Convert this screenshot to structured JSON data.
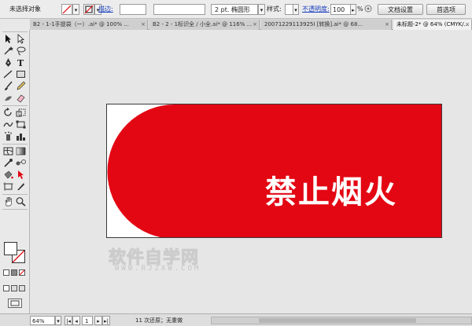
{
  "control_bar": {
    "selection_status": "未选择对象",
    "stroke_label": "描边:",
    "stroke_width": "2 pt. 椭圆形",
    "style_label": "样式:",
    "opacity_label": "不透明度:",
    "opacity_value": "100",
    "opacity_unit": "%",
    "doc_setup_button": "文档设置",
    "preferences_button": "首选项"
  },
  "tabs": [
    {
      "label": "B2 - 1-1手提袋（一）.ai* @ 100% ...",
      "active": false
    },
    {
      "label": "B2 - 2 - 1标识全 / 小全.ai* @ 116% ...",
      "active": false
    },
    {
      "label": "20071229113925I [转换].ai* @ 68...",
      "active": false
    },
    {
      "label": "未标题-2* @ 64% (CMYK/...",
      "active": true
    }
  ],
  "artboard": {
    "sign_text": "禁止烟火",
    "sign_color": "#e30613"
  },
  "watermark": {
    "main": "软件自学网",
    "sub": "WWW.RJZXW.COM"
  },
  "status_bar": {
    "zoom": "64%",
    "page": "1",
    "status_text": "11 次还原；无重做"
  },
  "icons": [
    "selection-tool-icon",
    "direct-selection-tool-icon",
    "magic-wand-icon",
    "lasso-icon",
    "pen-icon",
    "type-icon",
    "line-icon",
    "rectangle-icon",
    "paintbrush-icon",
    "pencil-icon",
    "blob-brush-icon",
    "eraser-icon",
    "rotate-icon",
    "scale-icon",
    "warp-icon",
    "free-transform-icon",
    "symbol-sprayer-icon",
    "graph-icon",
    "mesh-icon",
    "gradient-icon",
    "eyedropper-icon",
    "blend-icon",
    "live-paint-bucket-icon",
    "live-paint-selection-icon",
    "artboard-icon",
    "slice-icon",
    "hand-icon",
    "zoom-icon",
    "fill-stroke-icon"
  ]
}
